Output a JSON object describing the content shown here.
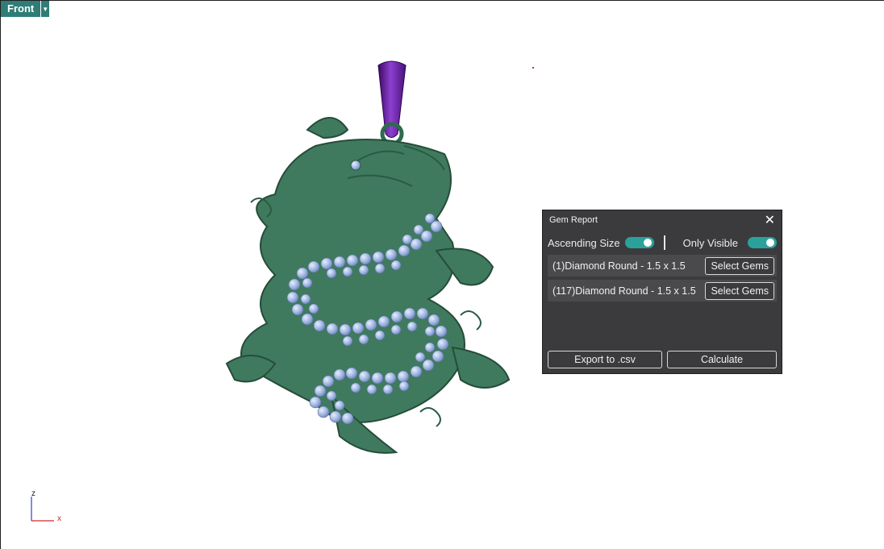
{
  "viewport": {
    "name": "Front",
    "axis_x": "x",
    "axis_z": "z"
  },
  "panel": {
    "title": "Gem Report",
    "ascending_size_label": "Ascending Size",
    "ascending_size_on": true,
    "only_visible_label": "Only Visible",
    "only_visible_on": true,
    "gems": [
      {
        "label": "(1)Diamond Round - 1.5 x 1.5",
        "button": "Select Gems"
      },
      {
        "label": "(117)Diamond Round - 1.5 x 1.5",
        "button": "Select Gems"
      }
    ],
    "export_label": "Export to .csv",
    "calculate_label": "Calculate"
  },
  "colors": {
    "accent": "#2aa19a",
    "panel_bg": "#3b3b3e",
    "model_green": "#3f7a5e",
    "gem_blue": "#a9bfe6",
    "bail_purple": "#6a1fa0"
  }
}
